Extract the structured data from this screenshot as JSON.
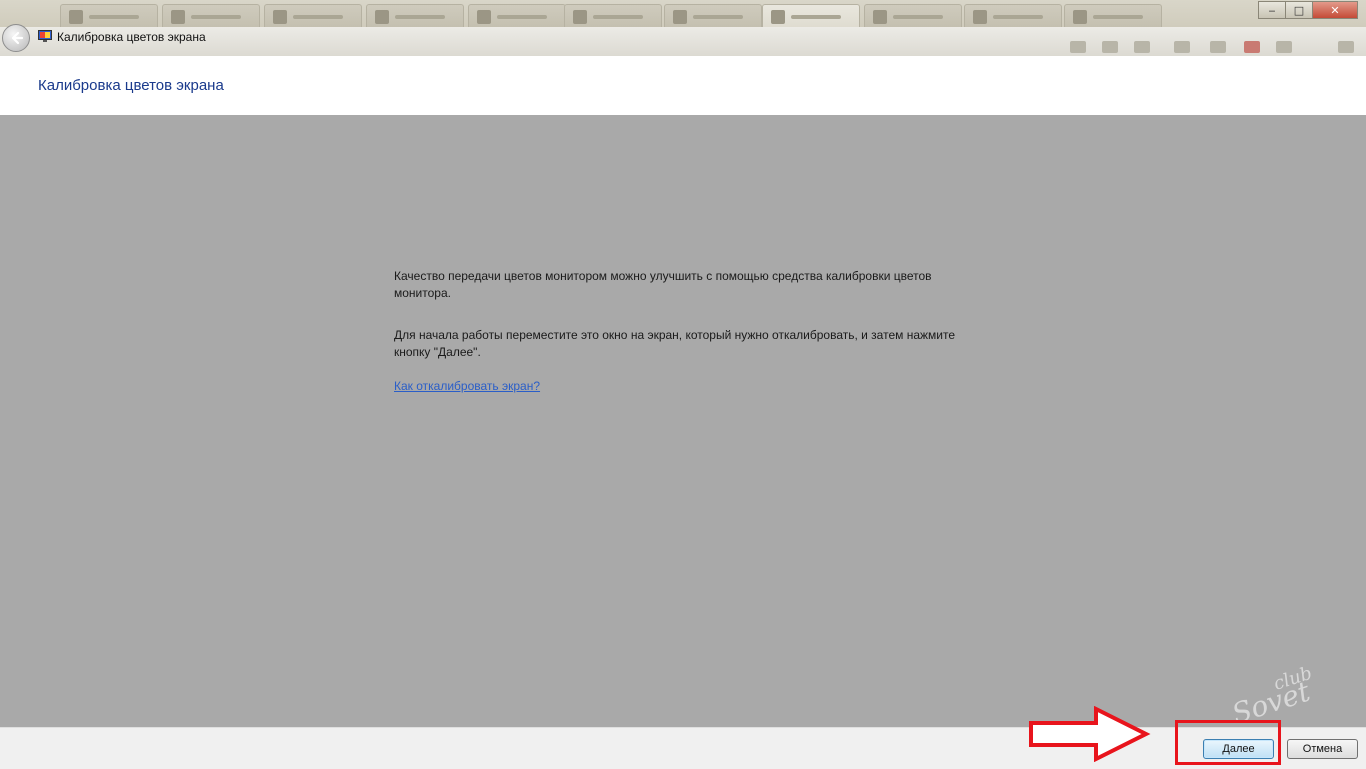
{
  "window": {
    "title": "Калибровка цветов экрана",
    "controls": {
      "minimize": "‒",
      "maximize": "□",
      "close": "✕"
    }
  },
  "header": {
    "title": "Калибровка цветов экрана"
  },
  "main": {
    "paragraph_1": "Качество передачи цветов монитором можно улучшить с помощью средства калибровки цветов монитора.",
    "paragraph_2": "Для начала работы переместите это окно на экран, который нужно откалибровать, и затем нажмите кнопку \"Далее\".",
    "help_link": "Как откалибровать экран?"
  },
  "footer": {
    "next_label": "Далее",
    "cancel_label": "Отмена"
  },
  "annotations": {
    "highlight_color": "#e8141c",
    "arrow": "arrow-right-icon"
  },
  "watermark": {
    "line1": "club",
    "line2": "Sovet"
  },
  "colors": {
    "content_background": "#a9a9a9",
    "header_background": "#ffffff",
    "title_color": "#1a3a8c",
    "link_color": "#2a5ec8",
    "footer_background": "#f0f0f0"
  }
}
